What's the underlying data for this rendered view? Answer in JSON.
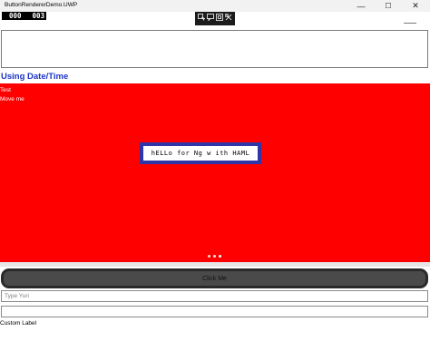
{
  "window": {
    "title": "ButtonRendererDemo.UWP",
    "minimize_glyph": "—",
    "maximize_glyph": "☐",
    "close_glyph": "✕"
  },
  "frame_counter": {
    "value_a": "000",
    "value_b": "003"
  },
  "debug_toolbar": {
    "icons": [
      "select-element-icon",
      "display-layout-icon",
      "track-focus-icon",
      "binding-failures-icon"
    ]
  },
  "main": {
    "section_title": "Using Date/Time",
    "test_label": "Test",
    "move_label": "Move me",
    "html_label": "hELLo for Ng w ith HAML",
    "carousel_indicators": {
      "count": 3,
      "active_index": 2
    }
  },
  "controls": {
    "button_label": "Click Me",
    "input_placeholder": "Type Yuri",
    "input_value": "",
    "second_input_value": "",
    "custom_label": "Custom Label"
  },
  "colors": {
    "accent_blue": "#1a33c4",
    "red_background": "#ff0000",
    "html_label_border": "#2f37a8",
    "button_background": "#4a4a4a"
  }
}
